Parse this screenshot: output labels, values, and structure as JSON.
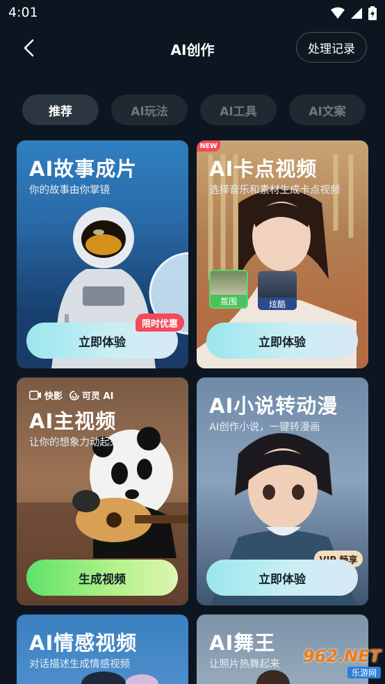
{
  "status": {
    "time": "4:01"
  },
  "header": {
    "title": "AI创作",
    "history_label": "处理记录"
  },
  "tabs": [
    {
      "label": "推荐",
      "active": true
    },
    {
      "label": "AI玩法",
      "active": false
    },
    {
      "label": "AI工具",
      "active": false
    },
    {
      "label": "AI文案",
      "active": false
    }
  ],
  "cards": {
    "story": {
      "title": "AI故事成片",
      "subtitle": "你的故事由你掌镜",
      "button": "立即体验",
      "badge": "限时优惠"
    },
    "beat": {
      "title": "AI卡点视频",
      "subtitle": "选择音乐和素材生成卡点视频",
      "button": "立即体验",
      "new_badge": "NEW",
      "thumb1": "氛围",
      "thumb2": "炫酷"
    },
    "main": {
      "brand1": "快影",
      "brand2": "可灵 AI",
      "title": "AI主视频",
      "subtitle": "让你的想象力动起来",
      "button": "生成视频"
    },
    "novel": {
      "title": "AI小说转动漫",
      "subtitle": "AI创作小说，一键转漫画",
      "button": "立即体验",
      "badge": "VIP 畅享"
    },
    "emotion": {
      "title": "AI情感视频",
      "subtitle": "对话描述生成情感视频"
    },
    "dance": {
      "title": "AI舞王",
      "subtitle": "让照片热舞起来"
    }
  },
  "watermark": {
    "main": "962.NET",
    "sub": "乐游网"
  },
  "colors": {
    "accent_blue": "#9ae6ee",
    "accent_green": "#5ee26a",
    "badge_red": "#f24a5b",
    "background": "#0d1620"
  }
}
